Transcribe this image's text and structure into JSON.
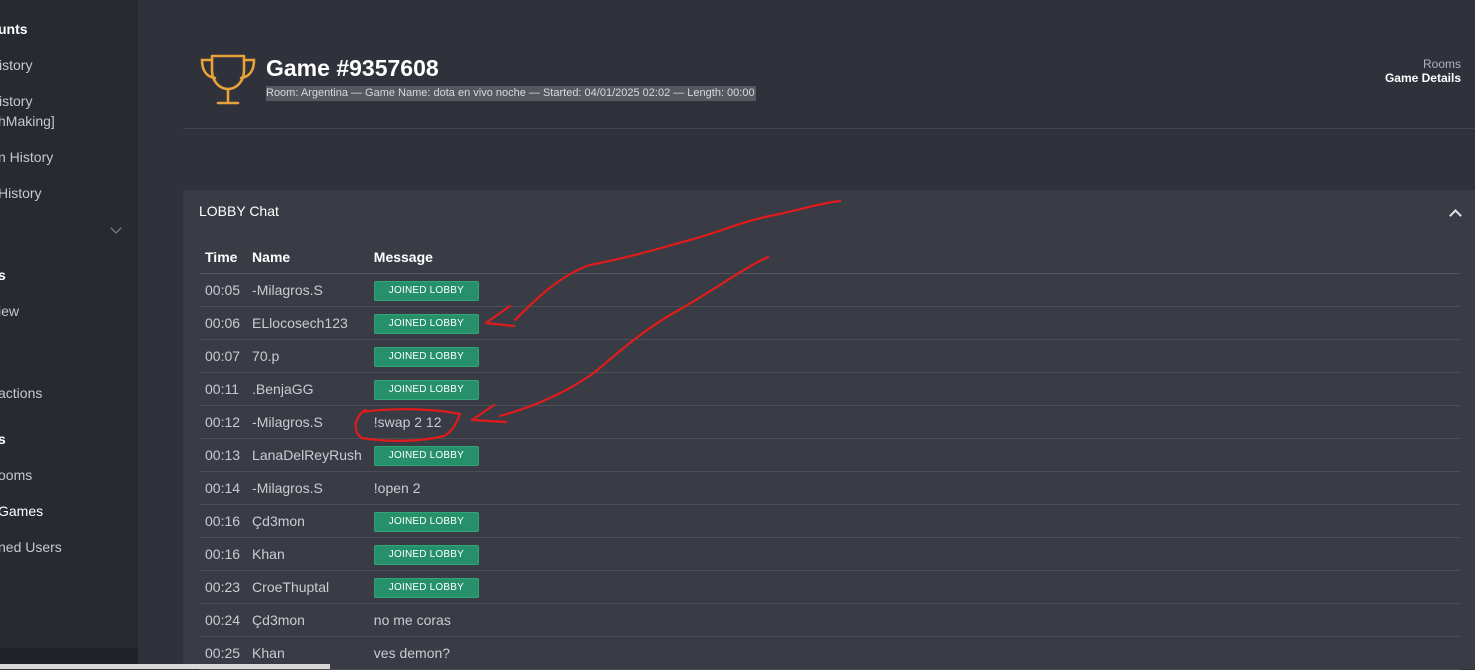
{
  "sidebar": {
    "items": [
      {
        "label": "unts",
        "kind": "header"
      },
      {
        "label": "istory",
        "kind": "item"
      },
      {
        "label": "istory",
        "kind": "item"
      },
      {
        "label": "hMaking]",
        "kind": "item"
      },
      {
        "label": "n History",
        "kind": "item"
      },
      {
        "label": " History",
        "kind": "item"
      },
      {
        "label": "s",
        "kind": "header"
      },
      {
        "label": "iew",
        "kind": "item"
      },
      {
        "label": "actions",
        "kind": "item"
      },
      {
        "label": "s",
        "kind": "header"
      },
      {
        "label": "ooms",
        "kind": "item"
      },
      {
        "label": " Games",
        "kind": "active"
      },
      {
        "label": "ned Users",
        "kind": "item"
      }
    ]
  },
  "header": {
    "title": "Game #9357608",
    "subtitle": "Room: Argentina — Game Name: dota en vivo noche — Started: 04/01/2025 02:02 — Length: 00:00",
    "icon": "trophy-icon",
    "accent_color": "#e8a23a"
  },
  "breadcrumb": {
    "parent": "Rooms",
    "current": "Game Details"
  },
  "panel": {
    "title": "LOBBY Chat",
    "columns": {
      "time": "Time",
      "name": "Name",
      "message": "Message"
    },
    "rows": [
      {
        "time": "00:05",
        "name": "-Milagros.S",
        "message": "JOINED LOBBY",
        "badge": true
      },
      {
        "time": "00:06",
        "name": "ELlocosech123",
        "message": "JOINED LOBBY",
        "badge": true
      },
      {
        "time": "00:07",
        "name": "70.p",
        "message": "JOINED LOBBY",
        "badge": true
      },
      {
        "time": "00:11",
        "name": ".BenjaGG",
        "message": "JOINED LOBBY",
        "badge": true
      },
      {
        "time": "00:12",
        "name": "-Milagros.S",
        "message": "!swap 2 12",
        "badge": false
      },
      {
        "time": "00:13",
        "name": "LanaDelReyRush",
        "message": "JOINED LOBBY",
        "badge": true
      },
      {
        "time": "00:14",
        "name": "-Milagros.S",
        "message": "!open 2",
        "badge": false
      },
      {
        "time": "00:16",
        "name": "Çd3mon",
        "message": "JOINED LOBBY",
        "badge": true
      },
      {
        "time": "00:16",
        "name": "Khan",
        "message": "JOINED LOBBY",
        "badge": true
      },
      {
        "time": "00:23",
        "name": "CroeThuptal",
        "message": "JOINED LOBBY",
        "badge": true
      },
      {
        "time": "00:24",
        "name": "Çd3mon",
        "message": "no me coras",
        "badge": false
      },
      {
        "time": "00:25",
        "name": "Khan",
        "message": "ves demon?",
        "badge": false
      }
    ],
    "badge_color": "#26906a"
  },
  "annotation_color": "#e11b1b"
}
